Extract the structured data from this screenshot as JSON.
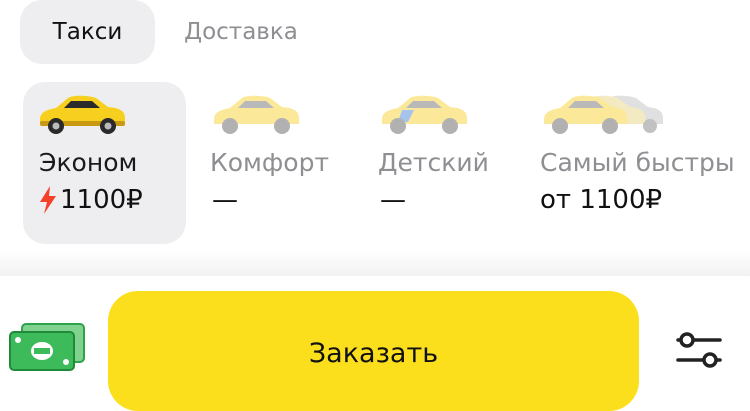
{
  "tabs": [
    {
      "label": "Такси",
      "active": true
    },
    {
      "label": "Доставка",
      "active": false
    }
  ],
  "tariffs": [
    {
      "name": "Эконом",
      "price": "1100₽",
      "surge": true,
      "selected": true,
      "car_icon": "car-yellow-icon"
    },
    {
      "name": "Комфорт",
      "price": "—",
      "selected": false,
      "car_icon": "car-yellow-icon"
    },
    {
      "name": "Детский",
      "price": "—",
      "selected": false,
      "car_icon": "car-kids-icon"
    },
    {
      "name": "Самый быстры",
      "price": "от 1100₽",
      "selected": false,
      "car_icon": "car-fleet-icon"
    }
  ],
  "payment": {
    "icon": "cash-icon"
  },
  "order_button": {
    "label": "Заказать"
  },
  "settings": {
    "icon": "settings-sliders-icon"
  },
  "colors": {
    "accent": "#fcdf1c",
    "surge": "#f5412a",
    "selected_bg": "#eeeef0",
    "muted_text": "#8e8e93"
  }
}
